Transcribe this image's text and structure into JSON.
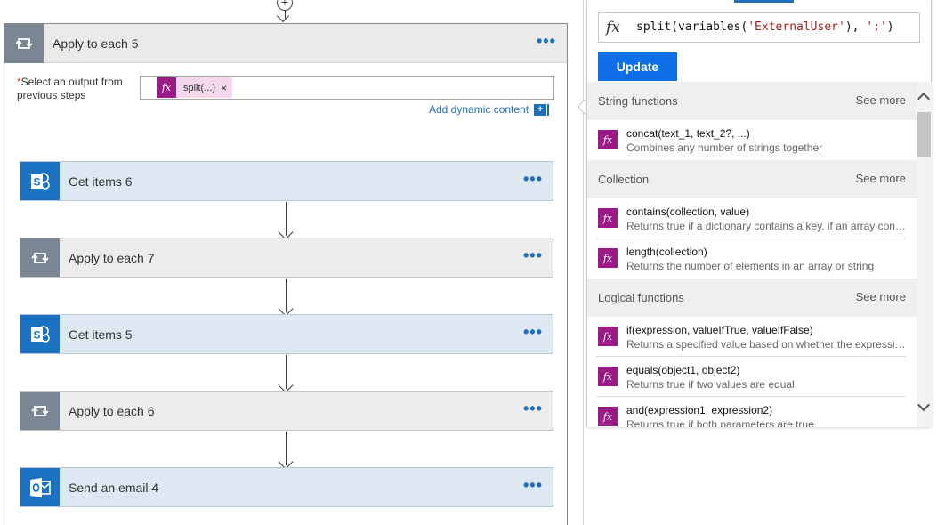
{
  "canvas": {
    "apply_each_5": {
      "title": "Apply to each 5",
      "dots": "•••",
      "select_label_star": "*",
      "select_label": "Select an output from previous steps",
      "token_icon": "fx",
      "token_text": "split(...)",
      "token_remove": "×",
      "add_dynamic": "Add dynamic content",
      "add_dynamic_plus": "+"
    },
    "steps": [
      {
        "title": "Get items 6",
        "kind": "sharepoint",
        "icon": "sharepoint-icon",
        "dots": "•••"
      },
      {
        "title": "Apply to each 7",
        "kind": "loop",
        "icon": "loop-icon",
        "dots": "•••"
      },
      {
        "title": "Get items 5",
        "kind": "sharepoint",
        "icon": "sharepoint-icon",
        "dots": "•••"
      },
      {
        "title": "Apply to each 6",
        "kind": "loop",
        "icon": "loop-icon",
        "dots": "•••"
      },
      {
        "title": "Send an email 4",
        "kind": "outlook",
        "icon": "outlook-icon",
        "dots": "•••"
      }
    ],
    "top_plus": "+"
  },
  "expression_panel": {
    "fx_glyph": "fx",
    "expression_prefix": "split(variables(",
    "expression_arg1": "'ExternalUser'",
    "expression_mid": "), ",
    "expression_arg2": "';'",
    "expression_suffix": ")",
    "update_label": "Update",
    "categories": [
      {
        "name": "String functions",
        "see_more": "See more",
        "functions": [
          {
            "name": "concat(text_1, text_2?, ...)",
            "desc": "Combines any number of strings together"
          }
        ]
      },
      {
        "name": "Collection",
        "see_more": "See more",
        "functions": [
          {
            "name": "contains(collection, value)",
            "desc": "Returns true if a dictionary contains a key, if an array cont..."
          },
          {
            "name": "length(collection)",
            "desc": "Returns the number of elements in an array or string"
          }
        ]
      },
      {
        "name": "Logical functions",
        "see_more": "See more",
        "functions": [
          {
            "name": "if(expression, valueIfTrue, valueIfFalse)",
            "desc": "Returns a specified value based on whether the expressio..."
          },
          {
            "name": "equals(object1, object2)",
            "desc": "Returns true if two values are equal"
          },
          {
            "name": "and(expression1, expression2)",
            "desc": "Returns true if both parameters are true"
          }
        ]
      }
    ],
    "fn_icon": "fx"
  },
  "colors": {
    "accent": "#1f6fbf",
    "update_button": "#0f6fe8",
    "fx_purple": "#9b1b86",
    "loop_gray": "#7a8693",
    "sharepoint_blue": "#1b72c1"
  }
}
